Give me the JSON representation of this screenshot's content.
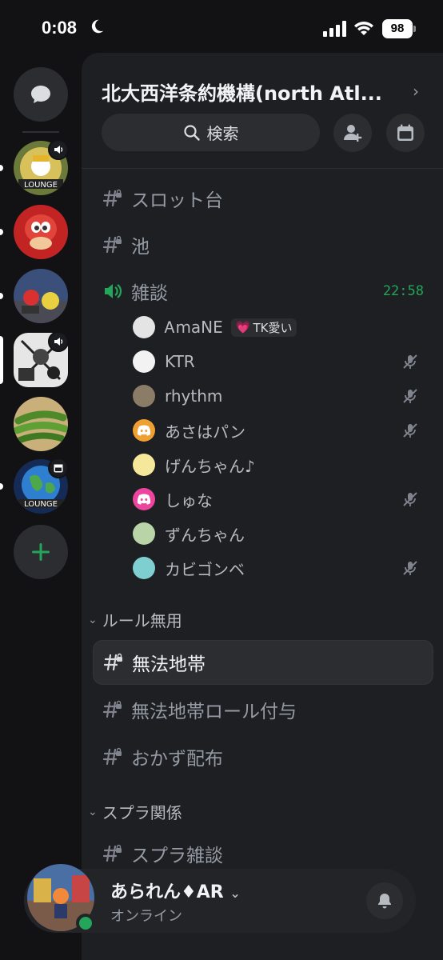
{
  "status_bar": {
    "time": "0:08",
    "battery": "98"
  },
  "guild": {
    "name": "北大西洋条約機構(north Atl...",
    "search_label": "検索"
  },
  "channels": {
    "top": [
      {
        "name": "スロット台"
      },
      {
        "name": "池"
      }
    ],
    "voice": {
      "name": "雑談",
      "time": "22:58"
    },
    "members": [
      {
        "name": "ᎪmaNE",
        "tag": "TK愛い",
        "muted": false
      },
      {
        "name": "KTR",
        "muted": true
      },
      {
        "name": "rhythm",
        "muted": true
      },
      {
        "name": "あさはパン",
        "muted": true
      },
      {
        "name": "げんちゃん♪",
        "muted": false
      },
      {
        "name": "しゅな",
        "muted": true
      },
      {
        "name": "ずんちゃん",
        "muted": false
      },
      {
        "name": "カビゴンベ",
        "muted": true
      }
    ],
    "categories": [
      {
        "name": "ルール無用",
        "items": [
          "無法地帯",
          "無法地帯ロール付与",
          "おかず配布"
        ]
      },
      {
        "name": "スプラ関係",
        "items": [
          "スプラ雑談"
        ]
      }
    ]
  },
  "user": {
    "name": "あられん♦AR",
    "status": "オンライン"
  },
  "colors": {
    "accent_green": "#23a55a",
    "background": "#1e1f22",
    "rail": "#121214"
  }
}
